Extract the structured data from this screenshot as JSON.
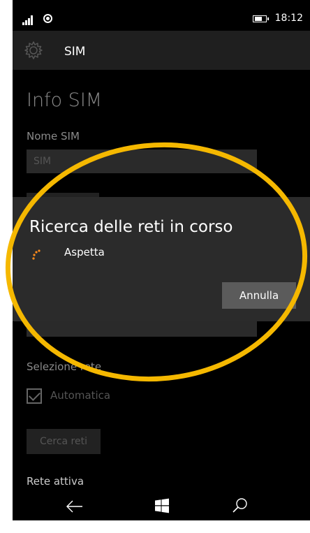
{
  "status_bar": {
    "time": "18:12"
  },
  "header": {
    "title": "SIM"
  },
  "page": {
    "title": "Info SIM",
    "sim_name_label": "Nome SIM",
    "sim_name_value": "SIM",
    "network_selection_label": "Selezione rete",
    "automatic_label": "Automatica",
    "automatic_checked": true,
    "search_networks_button": "Cerca reti",
    "active_network_label": "Rete attiva"
  },
  "dialog": {
    "title": "Ricerca delle reti in corso",
    "message": "Aspetta",
    "cancel_button": "Annulla"
  },
  "annotation": {
    "color": "#f5b800"
  }
}
